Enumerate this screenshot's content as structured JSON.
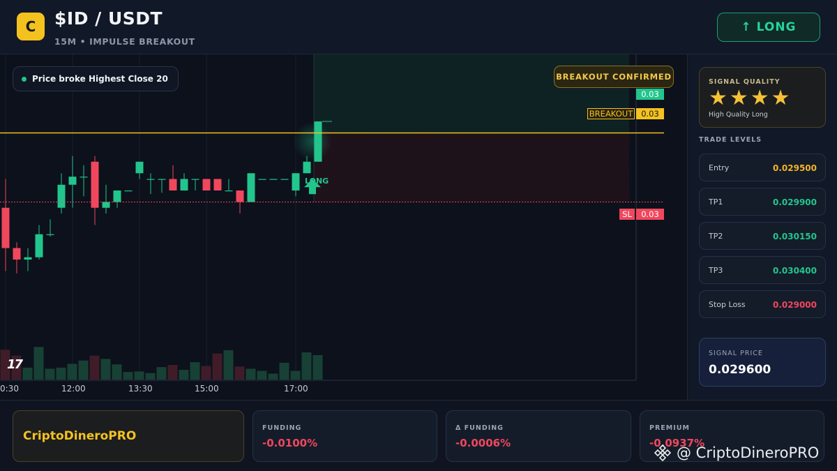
{
  "header": {
    "logo_letter": "C",
    "pair": "$ID / USDT",
    "subtitle": "15M • IMPULSE BREAKOUT",
    "signal_button": "↑ LONG"
  },
  "chart": {
    "status_pill": "Price broke Highest Close 20",
    "confirmed_badge": "BREAKOUT CONFIRMED",
    "breakout_label": "BREAKOUT",
    "breakout_price": "0.03",
    "current_price": "0.03",
    "sl_label": "SL",
    "sl_price": "0.03",
    "long_marker": "LONG",
    "tv_logo": "17",
    "time_labels": [
      "0:30",
      "12:00",
      "13:30",
      "15:00",
      "17:00"
    ],
    "colors": {
      "up": "#22c58c",
      "down": "#f0475d",
      "breakout": "#f4c21f",
      "background": "#0c111b"
    }
  },
  "chart_data": {
    "type": "candlestick",
    "x": [
      "0:30",
      "12:00",
      "13:30",
      "15:00",
      "17:00"
    ],
    "candles": [
      {
        "o": 0.02985,
        "h": 0.0301,
        "l": 0.0293,
        "c": 0.0295,
        "v": 55
      },
      {
        "o": 0.0295,
        "h": 0.02955,
        "l": 0.02928,
        "c": 0.0294,
        "v": 44
      },
      {
        "o": 0.0294,
        "h": 0.0295,
        "l": 0.0293,
        "c": 0.02942,
        "v": 22
      },
      {
        "o": 0.02942,
        "h": 0.0297,
        "l": 0.0294,
        "c": 0.02962,
        "v": 60
      },
      {
        "o": 0.02962,
        "h": 0.02975,
        "l": 0.0296,
        "c": 0.02962,
        "v": 20
      },
      {
        "o": 0.02985,
        "h": 0.03015,
        "l": 0.0298,
        "c": 0.03005,
        "v": 22
      },
      {
        "o": 0.03005,
        "h": 0.0303,
        "l": 0.02985,
        "c": 0.03012,
        "v": 29
      },
      {
        "o": 0.03012,
        "h": 0.03022,
        "l": 0.02995,
        "c": 0.03012,
        "v": 35
      },
      {
        "o": 0.03025,
        "h": 0.0303,
        "l": 0.0297,
        "c": 0.02985,
        "v": 44
      },
      {
        "o": 0.02985,
        "h": 0.03005,
        "l": 0.0298,
        "c": 0.0299,
        "v": 38
      },
      {
        "o": 0.0299,
        "h": 0.03,
        "l": 0.02985,
        "c": 0.03,
        "v": 28
      },
      {
        "o": 0.03,
        "h": 0.03,
        "l": 0.03,
        "c": 0.03,
        "v": 14
      },
      {
        "o": 0.03015,
        "h": 0.0302,
        "l": 0.0301,
        "c": 0.03025,
        "v": 15
      },
      {
        "o": 0.0301,
        "h": 0.03015,
        "l": 0.02997,
        "c": 0.0301,
        "v": 12
      },
      {
        "o": 0.0301,
        "h": 0.0301,
        "l": 0.02998,
        "c": 0.0301,
        "v": 23
      },
      {
        "o": 0.0301,
        "h": 0.03022,
        "l": 0.03,
        "c": 0.03,
        "v": 27
      },
      {
        "o": 0.03,
        "h": 0.03015,
        "l": 0.03,
        "c": 0.0301,
        "v": 18
      },
      {
        "o": 0.0301,
        "h": 0.0301,
        "l": 0.03,
        "c": 0.0301,
        "v": 32
      },
      {
        "o": 0.0301,
        "h": 0.0301,
        "l": 0.03,
        "c": 0.03,
        "v": 25
      },
      {
        "o": 0.0301,
        "h": 0.0301,
        "l": 0.03,
        "c": 0.03,
        "v": 48
      },
      {
        "o": 0.03,
        "h": 0.0301,
        "l": 0.03,
        "c": 0.03,
        "v": 54
      },
      {
        "o": 0.03,
        "h": 0.03,
        "l": 0.0298,
        "c": 0.0299,
        "v": 24
      },
      {
        "o": 0.0299,
        "h": 0.0301,
        "l": 0.0299,
        "c": 0.03015,
        "v": 20
      },
      {
        "o": 0.0301,
        "h": 0.0301,
        "l": 0.0301,
        "c": 0.0301,
        "v": 16
      },
      {
        "o": 0.0301,
        "h": 0.0301,
        "l": 0.0301,
        "c": 0.0301,
        "v": 11
      },
      {
        "o": 0.0301,
        "h": 0.0301,
        "l": 0.0301,
        "c": 0.0301,
        "v": 31
      },
      {
        "o": 0.03,
        "h": 0.03015,
        "l": 0.02995,
        "c": 0.03015,
        "v": 16
      },
      {
        "o": 0.03015,
        "h": 0.0303,
        "l": 0.03015,
        "c": 0.03025,
        "v": 50
      },
      {
        "o": 0.03025,
        "h": 0.0306,
        "l": 0.03025,
        "c": 0.0306,
        "v": 45
      }
    ],
    "levels": {
      "breakout": 0.0305,
      "sl": 0.0299
    },
    "ylim": [
      0.029,
      0.031
    ]
  },
  "signal_quality": {
    "title": "SIGNAL QUALITY",
    "stars": "★★★★",
    "stars_count": 4,
    "label": "High Quality Long"
  },
  "trade_levels": {
    "title": "TRADE LEVELS",
    "items": [
      {
        "name": "Entry",
        "value": "0.029500",
        "color": "#f4b324"
      },
      {
        "name": "TP1",
        "value": "0.029900",
        "color": "#22c58c"
      },
      {
        "name": "TP2",
        "value": "0.030150",
        "color": "#22c58c"
      },
      {
        "name": "TP3",
        "value": "0.030400",
        "color": "#22c58c"
      },
      {
        "name": "Stop Loss",
        "value": "0.029000",
        "color": "#f0475d"
      }
    ]
  },
  "signal_price": {
    "title": "SIGNAL PRICE",
    "value": "0.029600"
  },
  "bottom": {
    "brand": "CriptoDineroPRO",
    "stats": [
      {
        "title": "FUNDING",
        "value": "-0.0100%"
      },
      {
        "title": "Δ FUNDING",
        "value": "-0.0006%"
      },
      {
        "title": "PREMIUM",
        "value": "-0.0937%"
      }
    ],
    "watermark": "@ CriptoDineroPRO"
  }
}
